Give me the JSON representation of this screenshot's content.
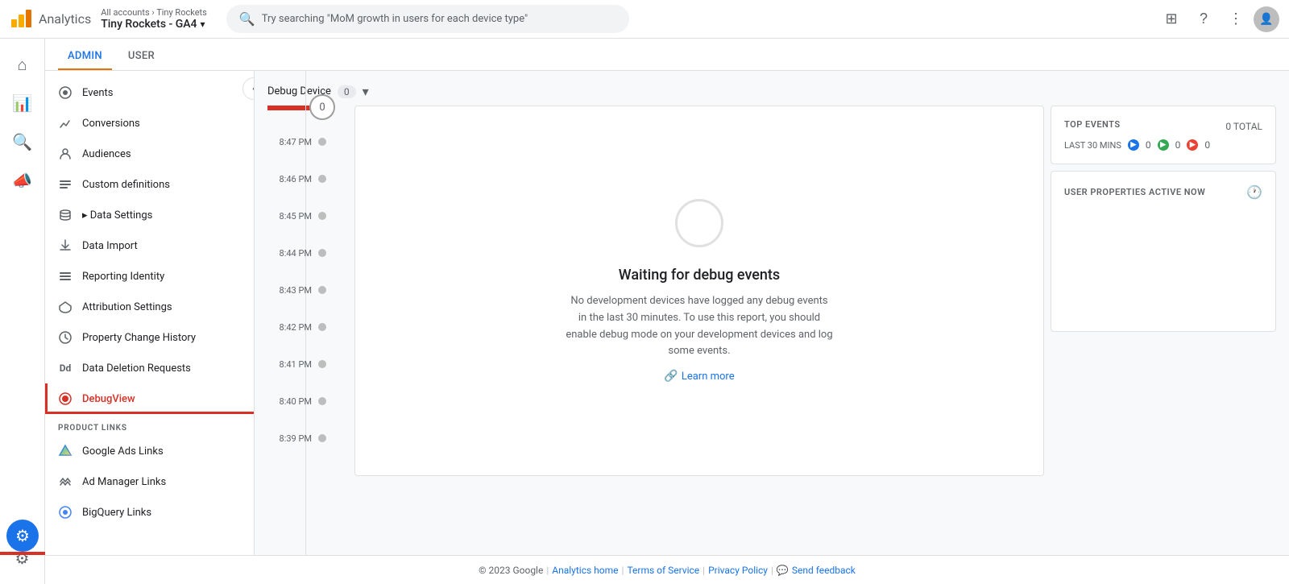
{
  "app": {
    "title": "Analytics",
    "logo_color1": "#F9AB00",
    "logo_color2": "#E37400",
    "logo_color3": "#F9AB00"
  },
  "topbar": {
    "breadcrumb": "All accounts › Tiny Rockets",
    "property": "Tiny Rockets - GA4",
    "search_placeholder": "Try searching \"MoM growth in users for each device type\""
  },
  "tabs": {
    "admin": "ADMIN",
    "user": "USER"
  },
  "sidebar": {
    "items": [
      {
        "label": "Events",
        "icon": "⚡"
      },
      {
        "label": "Conversions",
        "icon": "⚑"
      },
      {
        "label": "Audiences",
        "icon": "👤"
      },
      {
        "label": "Custom definitions",
        "icon": "☰"
      },
      {
        "label": "Data Settings",
        "icon": "🗄"
      },
      {
        "label": "Data Import",
        "icon": "⬆"
      },
      {
        "label": "Reporting Identity",
        "icon": "☰"
      },
      {
        "label": "Attribution Settings",
        "icon": "↺"
      },
      {
        "label": "Property Change History",
        "icon": "🕐"
      },
      {
        "label": "Data Deletion Requests",
        "icon": "Dd"
      },
      {
        "label": "DebugView",
        "icon": "◈"
      }
    ],
    "section_label": "PRODUCT LINKS",
    "product_links": [
      {
        "label": "Google Ads Links",
        "icon": "▲"
      },
      {
        "label": "Ad Manager Links",
        "icon": "⧖"
      },
      {
        "label": "BigQuery Links",
        "icon": "◉"
      }
    ]
  },
  "debug": {
    "device_label": "Debug Device",
    "device_count": "0",
    "timeline": [
      {
        "time": "8:47 PM"
      },
      {
        "time": "8:46 PM"
      },
      {
        "time": "8:45 PM"
      },
      {
        "time": "8:44 PM"
      },
      {
        "time": "8:43 PM"
      },
      {
        "time": "8:42 PM"
      },
      {
        "time": "8:41 PM"
      },
      {
        "time": "8:40 PM"
      },
      {
        "time": "8:39 PM"
      }
    ],
    "timeline_counter": "0"
  },
  "waiting": {
    "title": "Waiting for debug events",
    "description": "No development devices have logged any debug events in the last 30 minutes. To use this report, you should enable debug mode on your development devices and log some events.",
    "learn_more": "Learn more"
  },
  "top_events": {
    "title": "TOP EVENTS",
    "total_label": "0 TOTAL",
    "last_label": "LAST 30 MINS",
    "count_blue": "0",
    "count_green": "0",
    "count_red": "0"
  },
  "user_properties": {
    "title": "USER PROPERTIES ACTIVE NOW"
  },
  "footer": {
    "copyright": "© 2023 Google",
    "analytics_home": "Analytics home",
    "terms": "Terms of Service",
    "privacy": "Privacy Policy",
    "feedback": "Send feedback"
  }
}
